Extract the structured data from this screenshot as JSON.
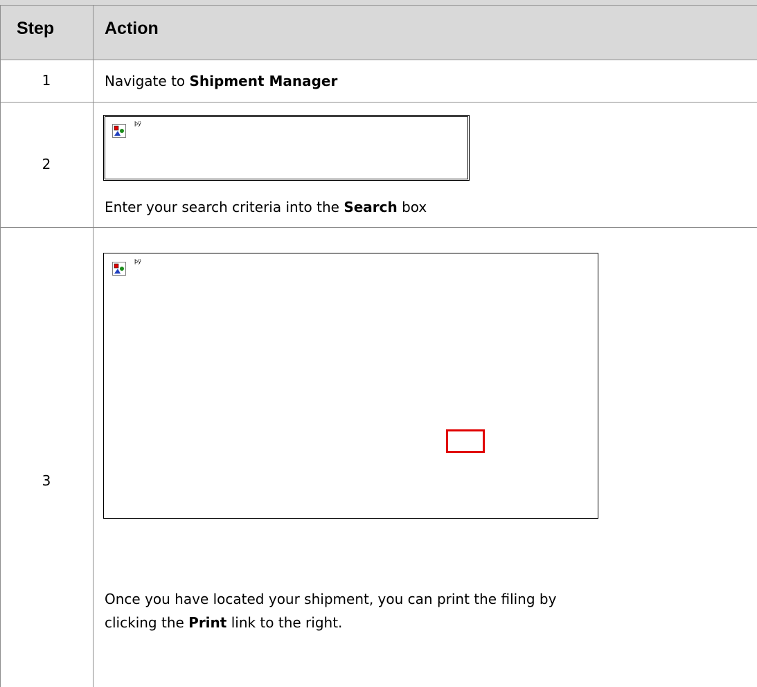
{
  "table": {
    "headers": {
      "step": "Step",
      "action": "Action"
    },
    "rows": [
      {
        "step": "1",
        "text_before": "Navigate to ",
        "bold": "Shipment Manager",
        "text_after": ""
      },
      {
        "step": "2",
        "image_alt": "þÿ",
        "text_before": "Enter your search criteria into the ",
        "bold": "Search",
        "text_after": " box"
      },
      {
        "step": "3",
        "image_alt": "þÿ",
        "line1": "Once you have located your shipment, you can print the filing by",
        "text_before": "clicking the ",
        "bold": "Print",
        "text_after": " link to the right."
      }
    ]
  },
  "colors": {
    "header_bg": "#d9d9d9",
    "border": "#8c8c8c",
    "highlight": "#e00000"
  }
}
